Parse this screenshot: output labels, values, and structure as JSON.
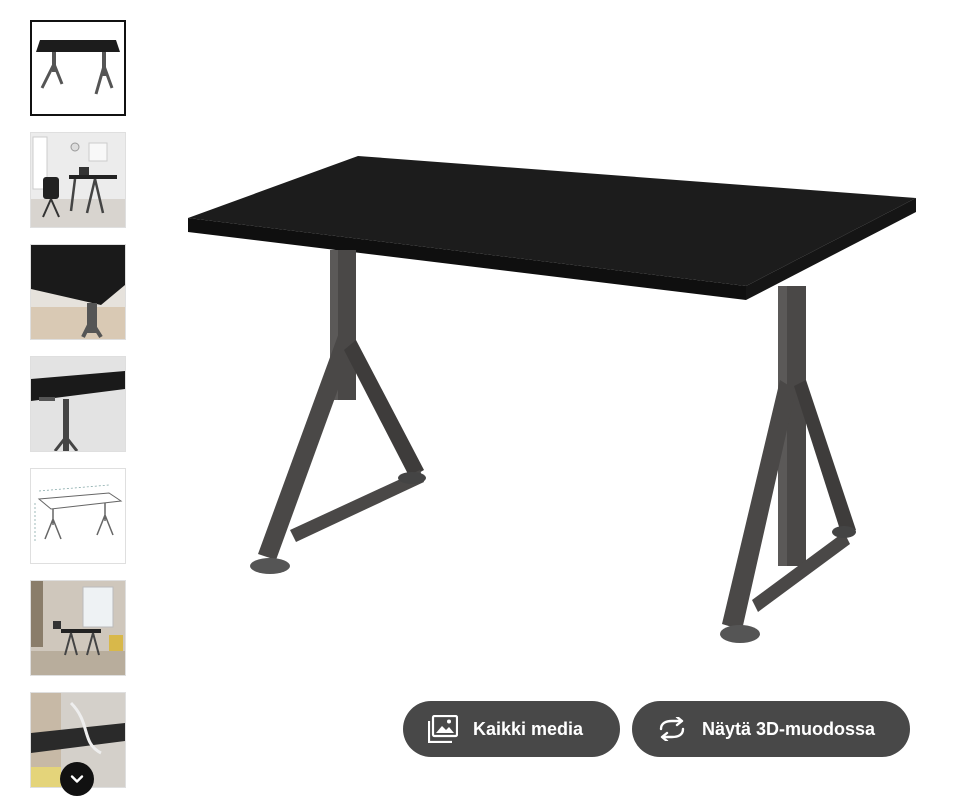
{
  "gallery": {
    "thumbnails": [
      {
        "name": "desk-front-view",
        "active": true
      },
      {
        "name": "desk-in-office-room",
        "active": false
      },
      {
        "name": "desk-corner-closeup",
        "active": false
      },
      {
        "name": "desk-underside-closeup",
        "active": false
      },
      {
        "name": "desk-dimension-drawing",
        "active": false
      },
      {
        "name": "desk-in-living-room",
        "active": false
      },
      {
        "name": "desk-cable-management",
        "active": false
      }
    ],
    "scroll_icon": "chevron-down-icon"
  },
  "actions": {
    "all_media_label": "Kaikki media",
    "all_media_icon": "gallery-icon",
    "view_3d_label": "Näytä 3D-muodossa",
    "view_3d_icon": "rotate-icon"
  },
  "colors": {
    "button_bg": "#484848",
    "button_text": "#ffffff",
    "desk_top": "#1c1c1c",
    "desk_legs": "#4a4847"
  }
}
